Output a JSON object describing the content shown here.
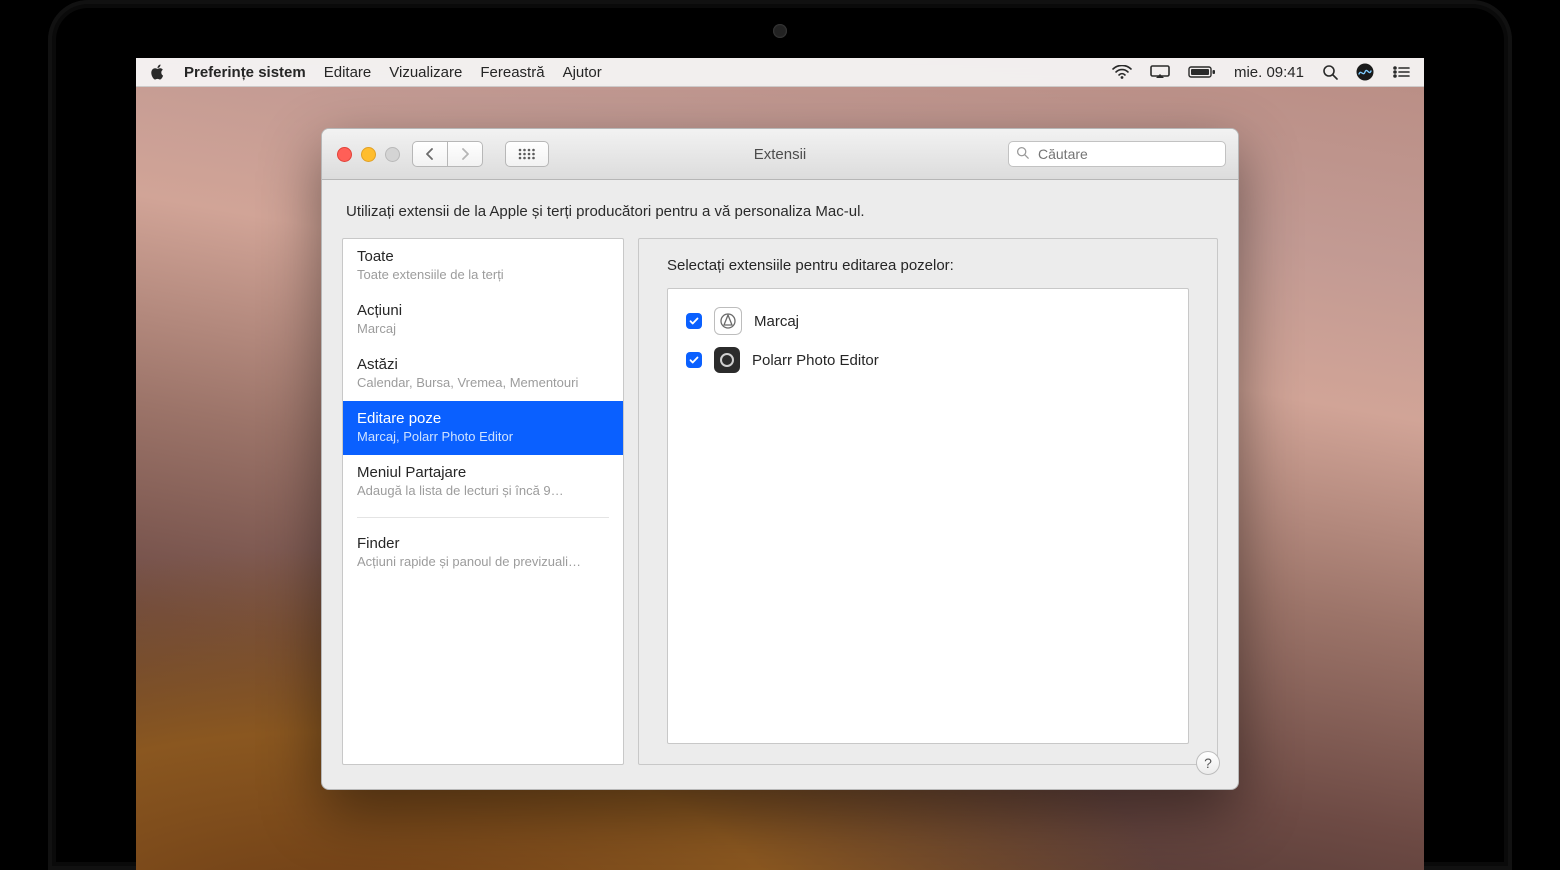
{
  "menu": {
    "app": "Preferințe sistem",
    "items": [
      "Editare",
      "Vizualizare",
      "Fereastră",
      "Ajutor"
    ],
    "clock": "mie. 09:41"
  },
  "window": {
    "title": "Extensii",
    "search_placeholder": "Căutare",
    "intro": "Utilizați extensii de la Apple și terți producători pentru a vă personaliza Mac-ul.",
    "help": "?"
  },
  "sidebar": [
    {
      "title": "Toate",
      "sub": "Toate extensiile de la terți",
      "selected": false
    },
    {
      "title": "Acțiuni",
      "sub": "Marcaj",
      "selected": false
    },
    {
      "title": "Astăzi",
      "sub": "Calendar, Bursa, Vremea, Mementouri",
      "selected": false
    },
    {
      "title": "Editare poze",
      "sub": "Marcaj, Polarr Photo Editor",
      "selected": true
    },
    {
      "title": "Meniul Partajare",
      "sub": "Adaugă la lista de lecturi și încă 9…",
      "selected": false
    },
    {
      "title": "Finder",
      "sub": "Acțiuni rapide și panoul de previzuali…",
      "selected": false,
      "divider_before": true
    }
  ],
  "detail": {
    "heading": "Selectați extensiile pentru editarea pozelor:",
    "rows": [
      {
        "name": "Marcaj",
        "icon": "markup",
        "checked": true
      },
      {
        "name": "Polarr Photo Editor",
        "icon": "polarr",
        "checked": true
      }
    ]
  },
  "colors": {
    "selection": "#0a60ff"
  }
}
